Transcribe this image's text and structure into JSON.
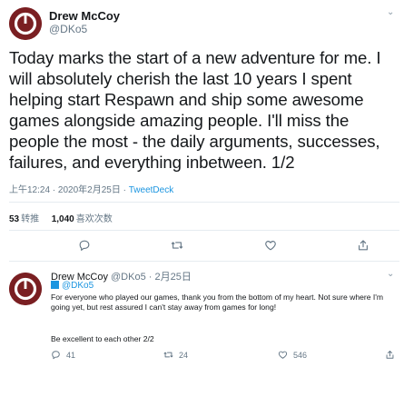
{
  "tweet": {
    "author_name": "Drew McCoy",
    "author_handle": "@DKo5",
    "text": "Today marks the start of a new adventure for me. I will absolutely cherish the last 10 years I spent helping start Respawn and ship some awesome games alongside amazing people. I'll miss the people the most - the daily arguments, successes, failures, and everything inbetween. 1/2",
    "time": "上午12:24 · 2020年2月25日",
    "separator": " · ",
    "source": "TweetDeck",
    "retweets_count": "53",
    "retweets_label": "转推",
    "likes_count": "1,040",
    "likes_label": "喜欢次数"
  },
  "actions": {
    "icons": [
      "reply-icon",
      "retweet-icon",
      "like-icon",
      "share-icon"
    ]
  },
  "reply": {
    "author_name": "Drew McCoy",
    "author_handle": "@DKo5",
    "date": "2月25日",
    "meta_sep": " · ",
    "replying_to": "@DKo5",
    "text": "For everyone who played our games, thank you from the bottom of my heart. Not sure where I'm going yet, but rest assured I can't stay away from games for long!",
    "text2": "Be excellent to each other 2/2",
    "reply_count": "41",
    "retweet_count": "24",
    "like_count": "546"
  },
  "colors": {
    "link": "#1b95e0",
    "muted": "#657786",
    "avatar": "#7a1f22"
  }
}
